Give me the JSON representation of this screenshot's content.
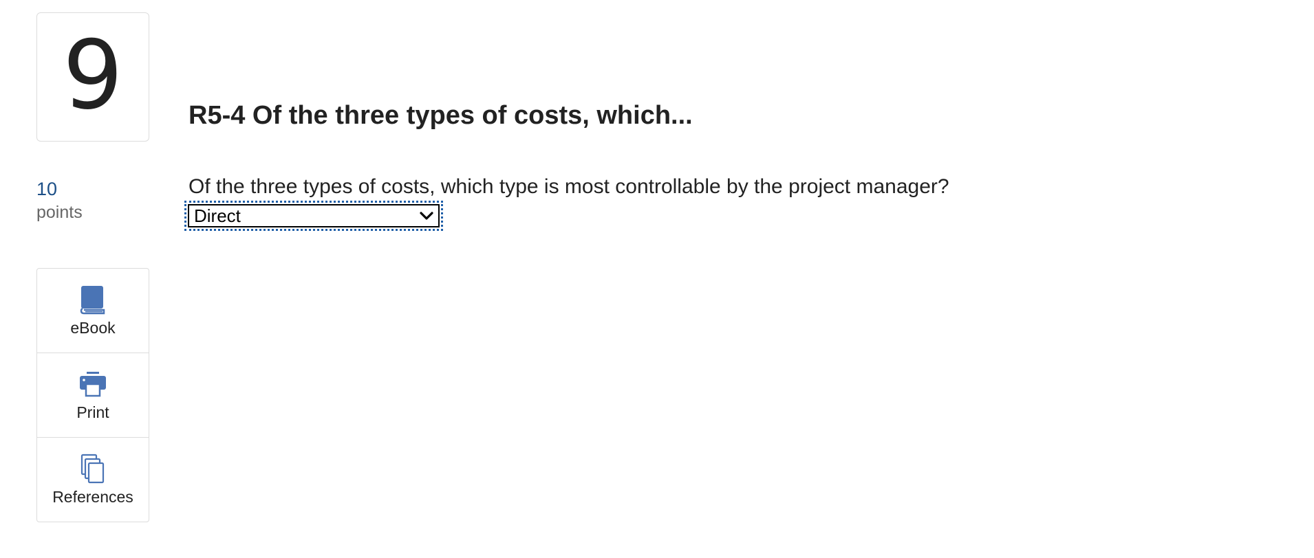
{
  "question": {
    "number": "9",
    "points_value": "10",
    "points_label": "points",
    "title": "R5-4 Of the three types of costs, which...",
    "prompt": "Of the three types of costs, which type is most controllable by the project manager?",
    "answer": {
      "selected": "Direct",
      "icon": "chevron-down-icon"
    }
  },
  "tools": [
    {
      "label": "eBook",
      "icon": "book-icon"
    },
    {
      "label": "Print",
      "icon": "printer-icon"
    },
    {
      "label": "References",
      "icon": "documents-icon"
    }
  ],
  "colors": {
    "accent": "#4a74b5",
    "points_value": "#1c4f87",
    "focus_outline": "#1f5fa8"
  }
}
